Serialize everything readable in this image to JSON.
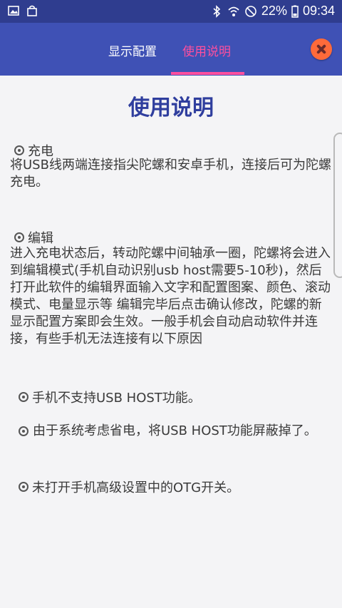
{
  "status": {
    "battery": "22%",
    "time": "09:34"
  },
  "tabs": [
    {
      "label": "显示配置"
    },
    {
      "label": "使用说明"
    }
  ],
  "content": {
    "title": "使用说明",
    "sections": [
      {
        "heading": "充电",
        "text": "将USB线两端连接指尖陀螺和安卓手机，连接后可为陀螺充电。"
      },
      {
        "heading": "编辑",
        "text": "进入充电状态后，转动陀螺中间轴承一圈，陀螺将会进入到编辑模式(手机自动识别usb host需要5-10秒)，然后打开此软件的编辑界面输入文字和配置图案、颜色、滚动模式、电量显示等 编辑完毕后点击确认修改，陀螺的新显示配置方案即会生效。一般手机会自动启动软件并连接，有些手机无法连接有以下原因"
      }
    ],
    "reasons": [
      "手机不支持USB HOST功能。",
      "由于系统考虑省电，将USB HOST功能屏蔽掉了。",
      "未打开手机高级设置中的OTG开关。"
    ]
  }
}
